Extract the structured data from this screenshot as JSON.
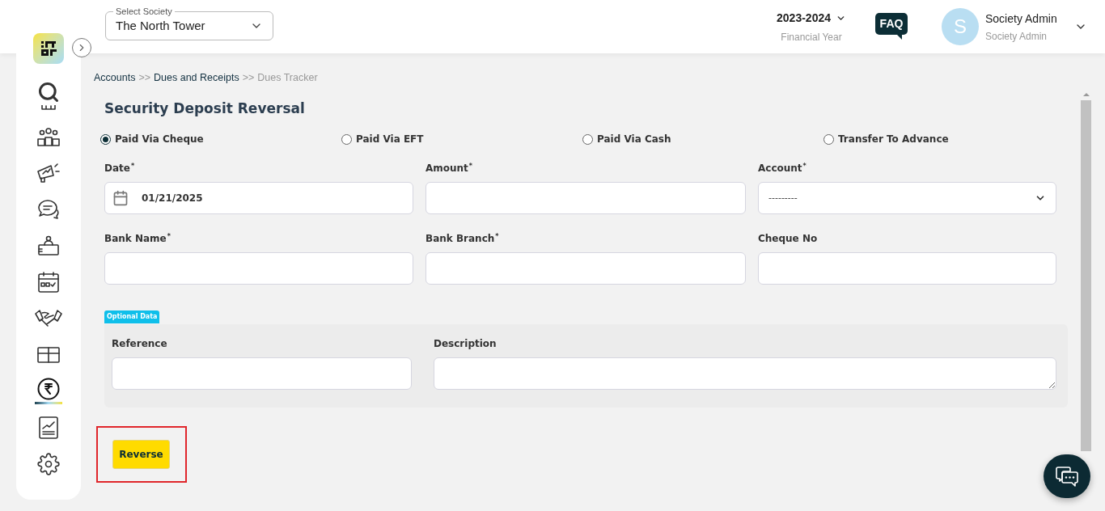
{
  "header": {
    "society_select": {
      "label": "Select Society",
      "value": "The North Tower"
    },
    "financial_year": {
      "value": "2023-2024",
      "caption": "Financial Year"
    },
    "faq": "FAQ",
    "user": {
      "initial": "S",
      "name": "Society Admin",
      "role": "Society Admin"
    }
  },
  "sidebar": {
    "items": [
      {
        "selected": false
      },
      {
        "selected": false
      },
      {
        "selected": false
      },
      {
        "selected": false
      },
      {
        "selected": false
      },
      {
        "selected": false
      },
      {
        "selected": false
      },
      {
        "selected": false
      },
      {
        "selected": false
      },
      {
        "selected": true
      },
      {
        "selected": false
      },
      {
        "selected": false
      }
    ]
  },
  "required_mark": "*",
  "breadcrumb": [
    {
      "label": "Accounts",
      "current": false
    },
    {
      "label": "Dues and Receipts",
      "current": false
    },
    {
      "label": "Dues Tracker",
      "current": true
    }
  ],
  "breadcrumb_separator": ">>",
  "title": "Security Deposit Reversal",
  "payment_modes": [
    {
      "label": "Paid Via Cheque",
      "selected": true
    },
    {
      "label": "Paid Via EFT",
      "selected": false
    },
    {
      "label": "Paid Via Cash",
      "selected": false
    },
    {
      "label": "Transfer To Advance",
      "selected": false
    }
  ],
  "fields": [
    {
      "label": "Date",
      "required": true,
      "kind": "date",
      "value": "01/21/2025"
    },
    {
      "label": "Amount",
      "required": true,
      "kind": "text"
    },
    {
      "label": "Account",
      "required": true,
      "kind": "select",
      "value": "---------"
    },
    {
      "label": "Bank Name",
      "required": true,
      "kind": "text"
    },
    {
      "label": "Bank Branch",
      "required": true,
      "kind": "text"
    },
    {
      "label": "Cheque No",
      "required": false,
      "kind": "text"
    }
  ],
  "optional": {
    "badge": "Optional Data",
    "fields": [
      {
        "label": "Reference",
        "kind": "text"
      },
      {
        "label": "Description",
        "kind": "textarea"
      }
    ]
  },
  "submit": "Reverse"
}
